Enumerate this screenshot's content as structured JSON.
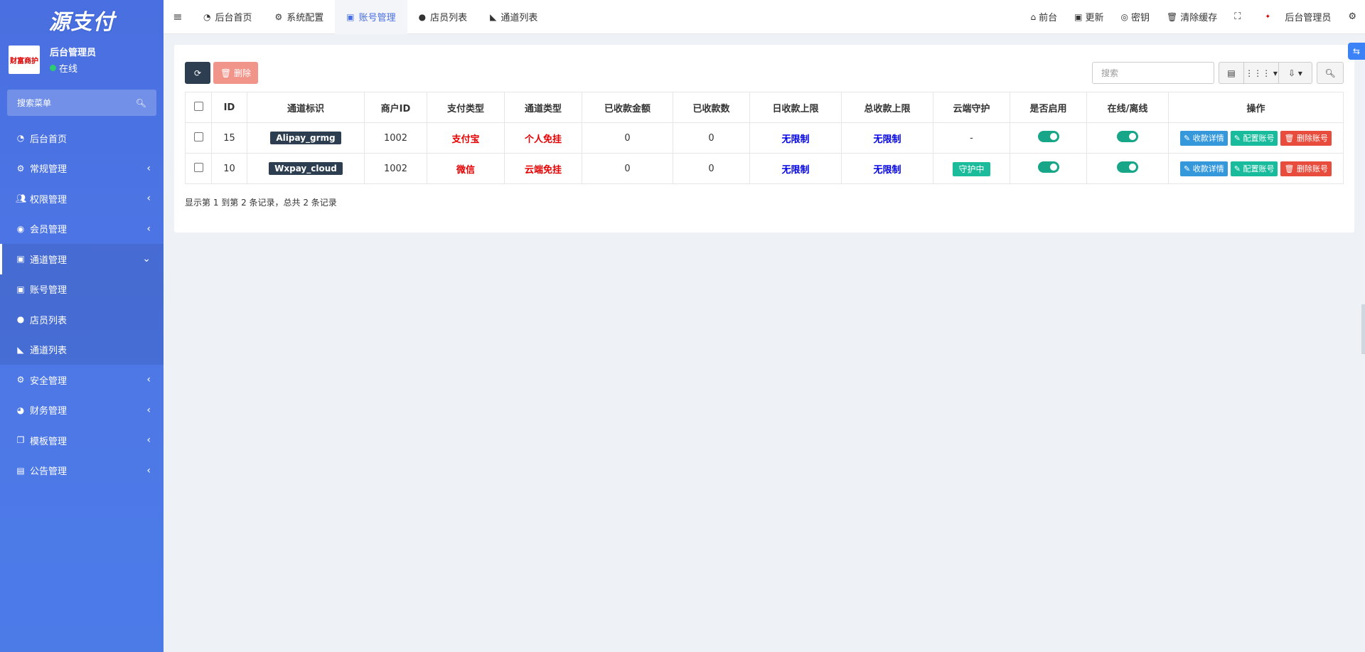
{
  "brand": {
    "logo_text": "源支付"
  },
  "user": {
    "name": "后台管理员",
    "status": "在线",
    "avatar_text": "财富商护"
  },
  "sidebar": {
    "search_label": "搜索菜单",
    "items": [
      {
        "label": "后台首页",
        "icon": "dashboard-icon"
      },
      {
        "label": "常规管理",
        "icon": "cogs-icon"
      },
      {
        "label": "权限管理",
        "icon": "group-icon"
      },
      {
        "label": "会员管理",
        "icon": "user-circle-icon"
      },
      {
        "label": "通道管理",
        "icon": "channel-icon"
      },
      {
        "label": "账号管理",
        "icon": "account-icon"
      },
      {
        "label": "店员列表",
        "icon": "wechat-icon"
      },
      {
        "label": "通道列表",
        "icon": "channel-list-icon"
      },
      {
        "label": "安全管理",
        "icon": "gear-icon"
      },
      {
        "label": "财务管理",
        "icon": "pie-chart-icon"
      },
      {
        "label": "模板管理",
        "icon": "clone-icon"
      },
      {
        "label": "公告管理",
        "icon": "file-icon"
      }
    ]
  },
  "navbar": {
    "tabs": [
      "后台首页",
      "系统配置",
      "账号管理",
      "店员列表",
      "通道列表"
    ],
    "right": {
      "frontend": "前台",
      "update": "更新",
      "key": "密钥",
      "clear_cache": "清除缓存",
      "admin": "后台管理员"
    }
  },
  "toolbar": {
    "delete_label": "删除",
    "search_placeholder": "搜索"
  },
  "table": {
    "headers": [
      "ID",
      "通道标识",
      "商户ID",
      "支付类型",
      "通道类型",
      "已收款金额",
      "已收款数",
      "日收款上限",
      "总收款上限",
      "云端守护",
      "是否启用",
      "在线/离线",
      "操作"
    ],
    "rows": [
      {
        "id": "15",
        "channel": "Alipay_grmg",
        "merchant": "1002",
        "pay_type": "支付宝",
        "channel_type": "个人免挂",
        "amount": "0",
        "count": "0",
        "day_limit": "无限制",
        "total_limit": "无限制",
        "guard": "-"
      },
      {
        "id": "10",
        "channel": "Wxpay_cloud",
        "merchant": "1002",
        "pay_type": "微信",
        "channel_type": "云端免挂",
        "amount": "0",
        "count": "0",
        "day_limit": "无限制",
        "total_limit": "无限制",
        "guard": "守护中"
      }
    ],
    "actions": {
      "detail": "收款详情",
      "config": "配置账号",
      "delete": "删除账号"
    }
  },
  "pager_text": "显示第 1 到第 2 条记录，总共 2 条记录"
}
